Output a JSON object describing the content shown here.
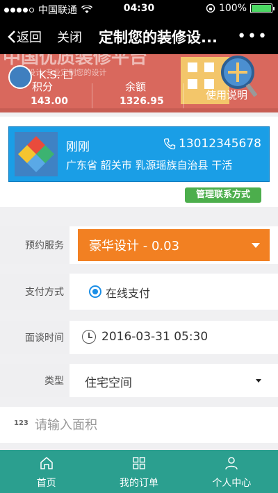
{
  "status_bar": {
    "carrier": "中国联通",
    "time": "04:30",
    "battery": "100%"
  },
  "nav": {
    "back": "返回",
    "close": "关闭",
    "title": "定制您的装修设...",
    "more": "•••"
  },
  "banner": {
    "bg_text": "中国优质装修平台",
    "bg_sub": "设计 专业定制您的设计",
    "username": "K.S.",
    "points_label": "积分",
    "points_value": "143.00",
    "balance_label": "余额",
    "balance_value": "1326.95",
    "help_label": "使用说明"
  },
  "contact": {
    "name": "刚刚",
    "phone": "13012345678",
    "address": "广东省 韶关市 乳源瑶族自治县 干活",
    "manage_button": "管理联系方式"
  },
  "form": {
    "service_label": "预约服务",
    "service_value": "豪华设计 - 0.03",
    "payment_label": "支付方式",
    "payment_value": "在线支付",
    "time_label": "面谈时间",
    "time_value": "2016-03-31 05:30",
    "type_label": "类型",
    "type_value": "住宅空间",
    "area_prefix": "123",
    "area_placeholder": "请输入面积"
  },
  "tabbar": {
    "home": "首页",
    "orders": "我的订单",
    "profile": "个人中心"
  },
  "colors": {
    "accent_orange": "#f28022",
    "card_blue": "#1a9ee6",
    "tab_teal": "#2b9f8f",
    "banner_red": "#d9685d",
    "manage_green": "#4cae4c"
  }
}
